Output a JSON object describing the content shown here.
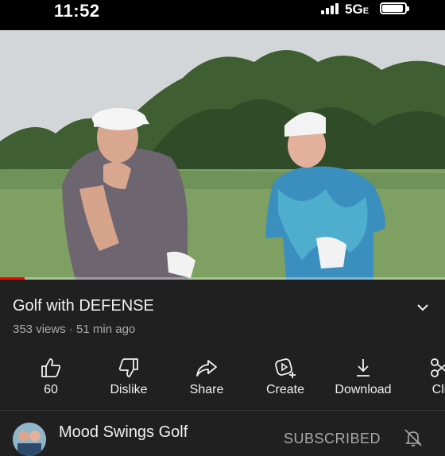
{
  "status_bar": {
    "time": "11:52",
    "network": "5G",
    "network_suffix": "E"
  },
  "video": {
    "progress_fraction": 0.055
  },
  "info": {
    "title": "Golf with DEFENSE",
    "meta": "353 views · 51 min ago"
  },
  "actions": [
    {
      "label": "60",
      "icon": "thumbs-up-icon"
    },
    {
      "label": "Dislike",
      "icon": "thumbs-down-icon"
    },
    {
      "label": "Share",
      "icon": "share-icon"
    },
    {
      "label": "Create",
      "icon": "create-icon"
    },
    {
      "label": "Download",
      "icon": "download-icon"
    },
    {
      "label": "Cli",
      "icon": "clip-icon"
    }
  ],
  "channel": {
    "name": "Mood Swings Golf",
    "subscribe_label": "SUBSCRIBED"
  },
  "colors": {
    "background": "#202020",
    "text": "#f1f1f1",
    "secondary_text": "#aaaaaa",
    "progress": "#ff0000"
  }
}
